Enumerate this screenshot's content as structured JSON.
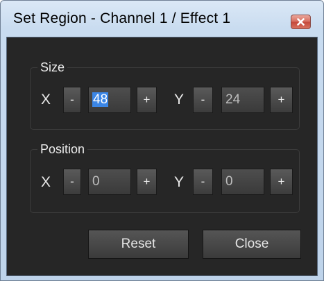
{
  "window": {
    "title": "Set Region - Channel 1 / Effect 1",
    "close_icon": "close-icon"
  },
  "size": {
    "legend": "Size",
    "x_label": "X",
    "y_label": "Y",
    "x_value": "48",
    "y_value": "24",
    "minus": "-",
    "plus": "+"
  },
  "position": {
    "legend": "Position",
    "x_label": "X",
    "y_label": "Y",
    "x_value": "0",
    "y_value": "0",
    "minus": "-",
    "plus": "+"
  },
  "buttons": {
    "reset": "Reset",
    "close": "Close"
  },
  "colors": {
    "dialog_background": "#262626",
    "titlebar": "#c9dcf0",
    "selection": "#3b86e6",
    "close_button": "#c4473a"
  }
}
